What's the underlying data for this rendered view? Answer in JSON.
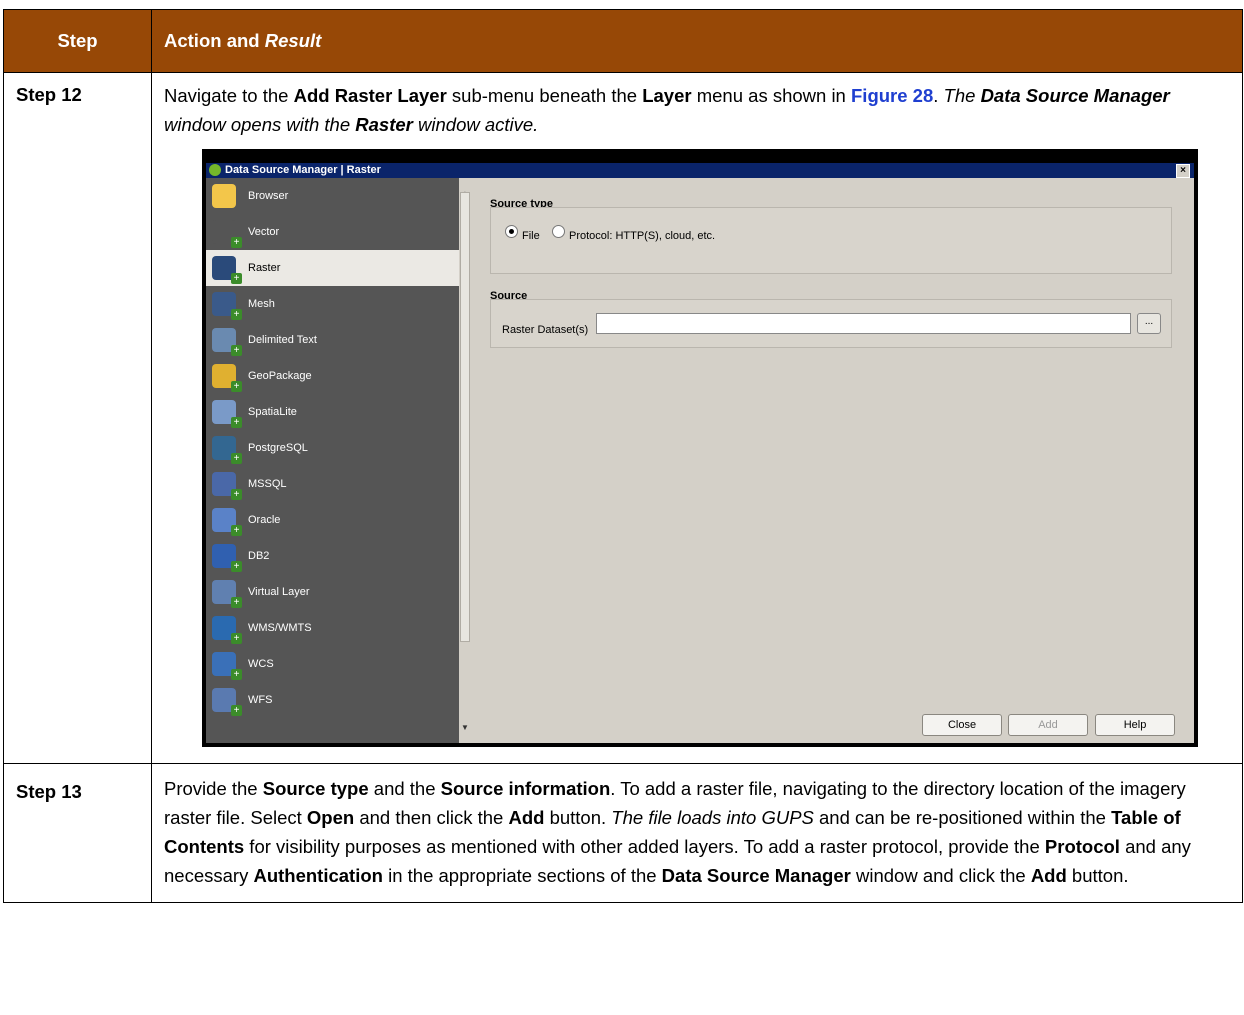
{
  "header": {
    "col1": "Step",
    "col2_plain": "Action and ",
    "col2_italic": "Result"
  },
  "step12": {
    "label": "Step 12",
    "t1": "Navigate to the ",
    "b1": "Add Raster Layer",
    "t2": " sub-menu beneath the ",
    "b2": "Layer",
    "t3": " menu as shown in ",
    "link": "Figure 28",
    "t4": ". ",
    "i1": "The ",
    "bi1": "Data Source Manager",
    "i2": " window opens with the ",
    "bi2": "Raster",
    "i3": " window active."
  },
  "dialog": {
    "title": "Data Source Manager | Raster",
    "close_glyph": "×",
    "sidebar": [
      {
        "label": "Browser",
        "icon": "folder-icon",
        "color": "#f3c64a"
      },
      {
        "label": "Vector",
        "icon": "vector-icon",
        "color": "#555555"
      },
      {
        "label": "Raster",
        "icon": "raster-icon",
        "color": "#2a4a7a"
      },
      {
        "label": "Mesh",
        "icon": "mesh-icon",
        "color": "#3a5a8a"
      },
      {
        "label": "Delimited Text",
        "icon": "delimited-text-icon",
        "color": "#6a8ab0"
      },
      {
        "label": "GeoPackage",
        "icon": "geopackage-icon",
        "color": "#e0b030"
      },
      {
        "label": "SpatiaLite",
        "icon": "spatialite-icon",
        "color": "#7a9ac8"
      },
      {
        "label": "PostgreSQL",
        "icon": "postgresql-icon",
        "color": "#336791"
      },
      {
        "label": "MSSQL",
        "icon": "mssql-icon",
        "color": "#4a68a8"
      },
      {
        "label": "Oracle",
        "icon": "oracle-icon",
        "color": "#5a82c8"
      },
      {
        "label": "DB2",
        "icon": "db2-icon",
        "color": "#3060b0"
      },
      {
        "label": "Virtual Layer",
        "icon": "virtual-layer-icon",
        "color": "#6080b0"
      },
      {
        "label": "WMS/WMTS",
        "icon": "wms-icon",
        "color": "#2a6ab0"
      },
      {
        "label": "WCS",
        "icon": "wcs-icon",
        "color": "#3a70b8"
      },
      {
        "label": "WFS",
        "icon": "wfs-icon",
        "color": "#5a7ab0"
      }
    ],
    "source_type_title": "Source type",
    "radio_file": "File",
    "radio_protocol": "Protocol: HTTP(S), cloud, etc.",
    "source_title": "Source",
    "raster_label": "Raster Dataset(s)",
    "raster_value": "",
    "browse_label": "...",
    "buttons": {
      "close": "Close",
      "add": "Add",
      "help": "Help"
    }
  },
  "step13": {
    "label": "Step 13",
    "t1": "Provide the ",
    "b1": "Source type",
    "t2": " and the ",
    "b2": "Source information",
    "t3": ". To add a raster file, navigating to the directory location of the imagery raster file. Select ",
    "b3": "Open",
    "t4": " and then click the ",
    "b4": "Add",
    "t5": " button. ",
    "i1": "The file loads into GUPS",
    "t6": " and can be re-positioned within the ",
    "b5": "Table of Contents",
    "t7": " for visibility purposes as mentioned with other added layers. To add a raster protocol, provide the ",
    "b6": "Protocol",
    "t8": " and any necessary ",
    "b7": "Authentication",
    "t9": " in the appropriate sections of the ",
    "b8": "Data Source Manager",
    "t10": " window and click the ",
    "b9": "Add",
    "t11": " button."
  }
}
